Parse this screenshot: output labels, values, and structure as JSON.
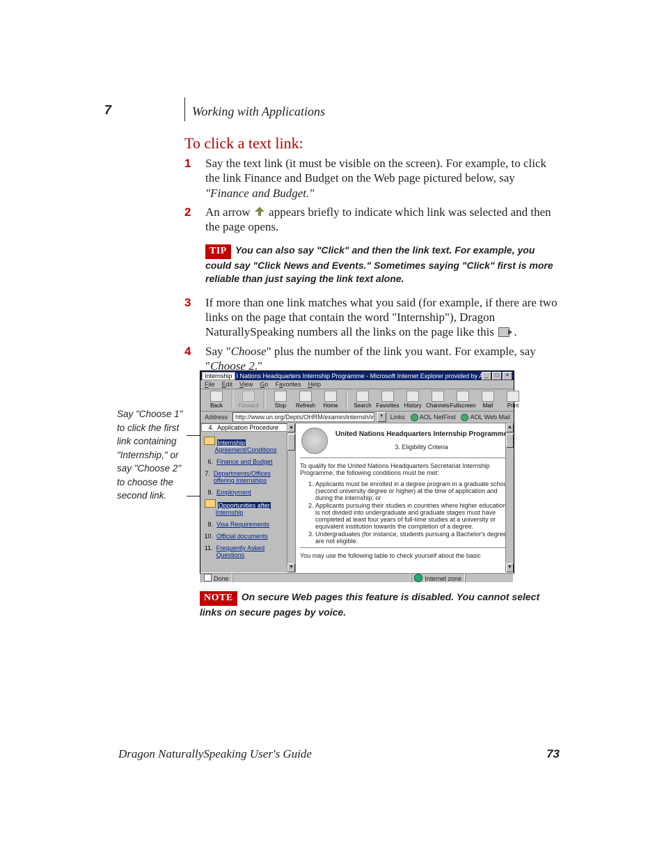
{
  "chapter_number": "7",
  "chapter_title": "Working with Applications",
  "section_heading": "To click a text link:",
  "steps": {
    "s1_pre": "Say the text link (it must be visible on the screen). For example, to click the link Finance and Budget on the Web page pictured below, say ",
    "s1_em": "\"Finance and Budget.\"",
    "s2_pre": "An arrow ",
    "s2_post": " appears briefly to indicate which link was selected and then the page opens.",
    "s3_pre": "If more than one link matches what you said (for example, if there are two links on the page that contain the word \"Internship\"), Dragon NaturallySpeaking numbers all the links on the page like this ",
    "s3_post": " .",
    "s4_pre": "Say \"",
    "s4_em1": "Choose",
    "s4_mid": "\" plus the number of the link you want. For example, say \"",
    "s4_em2": "Choose 2",
    "s4_post": ".\""
  },
  "tip_label": "TIP",
  "tip_text": "You can also say \"Click\" and then the link text. For example, you could say \"Click News and Events.\" Sometimes saying \"Click\" first is more reliable than just saying the link text alone.",
  "note_label": "NOTE",
  "note_text": "On secure Web pages this feature is disabled. You cannot select links on secure pages by voice.",
  "annotation": "Say \"Choose 1\" to click the first link containing \"Internship,\" or say \"Choose 2\" to choose the second link.",
  "browser": {
    "title_tag": "Internship",
    "title": "I Nations Headquarters Internship Programme - Microsoft Internet Explorer provided by America Online",
    "menus": [
      "File",
      "Edit",
      "View",
      "Go",
      "Favorites",
      "Help"
    ],
    "toolbar": [
      {
        "label": "Back",
        "enabled": true
      },
      {
        "label": "Forward",
        "enabled": false
      },
      {
        "label": "Stop",
        "enabled": true
      },
      {
        "label": "Refresh",
        "enabled": true
      },
      {
        "label": "Home",
        "enabled": true
      },
      {
        "label": "Search",
        "enabled": true
      },
      {
        "label": "Favorites",
        "enabled": true
      },
      {
        "label": "History",
        "enabled": true
      },
      {
        "label": "Channels",
        "enabled": true
      },
      {
        "label": "Fullscreen",
        "enabled": true
      },
      {
        "label": "Mail",
        "enabled": true
      },
      {
        "label": "Print",
        "enabled": true
      }
    ],
    "address_label": "Address",
    "address_url": "http://www.un.org/Depts/OHRM/examin/internsh/intern.htm",
    "links_label": "Links",
    "quick_links": [
      "AOL NetFind",
      "AOL Web Mail"
    ],
    "sidebar_header": "Application Procedure",
    "sidebar_items": [
      {
        "n": "4.",
        "sel": "Internship",
        "rest": " Agreement/Conditions"
      },
      {
        "n": "6.",
        "link": "Finance and Budget"
      },
      {
        "n": "7.",
        "link": "Departments/Offices offering Internships"
      },
      {
        "n": "8.",
        "link": "Employment"
      },
      {
        "n": "",
        "sel": "Opportunities after",
        "rest": " Internship"
      },
      {
        "n": "8.",
        "link": "Visa Requirements"
      },
      {
        "n": "10.",
        "link": "Official documents"
      },
      {
        "n": "11.",
        "link": "Frequently Asked Questions"
      }
    ],
    "main_heading": "United Nations Headquarters Internship Programme",
    "main_subheading": "3. Eligibility Criteria",
    "main_intro": "To qualify for the United Nations Headquarters Secretariat Internship Programme, the following conditions must be met:",
    "main_list": [
      "Applicants must be enrolled in a degree program in a graduate school (second university degree or higher) at the time of application and during the internship; or",
      "Applicants pursuing their studies in countries where higher education is not divided into undergraduate and graduate stages must have completed at least four years of full-time studies at a university or equivalent institution towards the completion of a degree.",
      "Undergraduates (for instance, students pursuing a Bachelor's degree) are not eligible."
    ],
    "main_tail": "You may use the following table to check yourself about the basic",
    "status_done": "Done",
    "status_zone": "Internet zone"
  },
  "footer_title": "Dragon NaturallySpeaking User's Guide",
  "footer_page": "73"
}
